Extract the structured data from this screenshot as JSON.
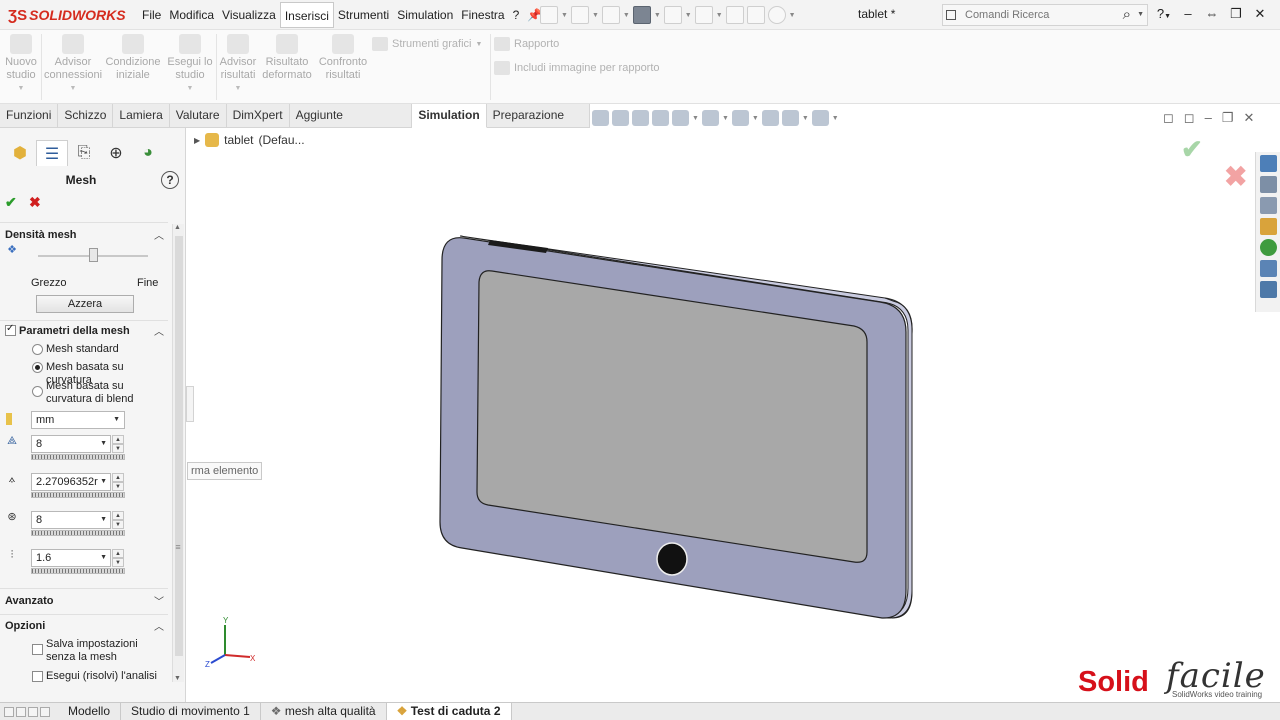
{
  "app": {
    "brand": "SOLIDWORKS",
    "doc_title": "tablet *"
  },
  "menu": [
    "File",
    "Modifica",
    "Visualizza",
    "Inserisci",
    "Strumenti",
    "Simulation",
    "Finestra",
    "?"
  ],
  "search": {
    "placeholder": "Comandi Ricerca"
  },
  "command_manager": {
    "buttons": [
      {
        "label": "Nuovo studio"
      },
      {
        "label": "Advisor connessioni"
      },
      {
        "label": "Condizione iniziale"
      },
      {
        "label": "Esegui lo studio"
      },
      {
        "label": "Advisor risultati"
      },
      {
        "label": "Risultato deformato"
      },
      {
        "label": "Confronto risultati"
      }
    ],
    "graphic_tools": "Strumenti grafici",
    "report": "Rapporto",
    "include_image": "Includi immagine per rapporto"
  },
  "tabs": [
    "Funzioni",
    "Schizzo",
    "Lamiera",
    "Valutare",
    "DimXpert",
    "Aggiunte SOLIDWORKS",
    "Simulation",
    "Preparazione analisi"
  ],
  "active_tab": "Simulation",
  "panel": {
    "title": "Mesh",
    "help": "?",
    "density": {
      "header": "Densità mesh",
      "left": "Grezzo",
      "right": "Fine",
      "reset": "Azzera",
      "level": 0.5
    },
    "params": {
      "header": "Parametri della mesh",
      "checked": true,
      "options": [
        "Mesh standard",
        "Mesh basata su curvatura",
        "Mesh basata su curvatura di blend"
      ],
      "selected": 1,
      "unit": "mm",
      "max_size": "8",
      "min_size": "2.27096352r",
      "elements_circle": "8",
      "growth_ratio": "1.6"
    },
    "advanced": {
      "header": "Avanzato"
    },
    "options": {
      "header": "Opzioni",
      "save_without_mesh": "Salva impostazioni senza la mesh",
      "run_analysis": "Esegui (risolvi) l'analisi"
    }
  },
  "tree": {
    "label": "tablet",
    "config": "(Defau..."
  },
  "tooltip": "rma elemento",
  "triad": {
    "x": "X",
    "y": "Y",
    "z": "Z"
  },
  "watermark": {
    "solid": "Solid",
    "facile": "facile",
    "tagline": "SolidWorks video training"
  },
  "bottom_tabs": [
    "Modello",
    "Studio di movimento 1",
    "mesh alta qualità",
    "Test di caduta 2"
  ],
  "active_bottom_tab": "Test di caduta 2",
  "colors": {
    "brand_red": "#d52b1e",
    "tablet_body": "#9da0bd",
    "screen": "#a8a8a8"
  }
}
